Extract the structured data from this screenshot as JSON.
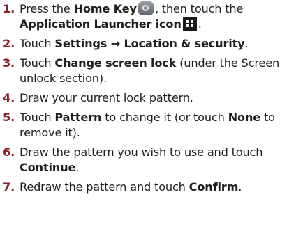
{
  "steps": [
    {
      "num": "1.",
      "parts": [
        {
          "t": "Press the "
        },
        {
          "t": "Home Key",
          "b": true
        },
        {
          "icon": "home-key-icon"
        },
        {
          "t": ", then touch the "
        },
        {
          "t": "Application Launcher icon",
          "b": true
        },
        {
          "icon": "app-launcher-icon"
        },
        {
          "t": "."
        }
      ]
    },
    {
      "num": "2.",
      "parts": [
        {
          "t": "Touch "
        },
        {
          "t": "Settings → Location & security",
          "b": true
        },
        {
          "t": "."
        }
      ]
    },
    {
      "num": "3.",
      "parts": [
        {
          "t": "Touch "
        },
        {
          "t": "Change screen lock",
          "b": true
        },
        {
          "t": " (under the Screen unlock section)."
        }
      ]
    },
    {
      "num": "4.",
      "parts": [
        {
          "t": "Draw your current lock pattern."
        }
      ]
    },
    {
      "num": "5.",
      "parts": [
        {
          "t": "Touch "
        },
        {
          "t": "Pattern",
          "b": true
        },
        {
          "t": " to change it (or touch "
        },
        {
          "t": "None",
          "b": true
        },
        {
          "t": " to remove it)."
        }
      ]
    },
    {
      "num": "6.",
      "parts": [
        {
          "t": "Draw the pattern you wish to use and touch "
        },
        {
          "t": "Continue",
          "b": true
        },
        {
          "t": "."
        }
      ]
    },
    {
      "num": "7.",
      "parts": [
        {
          "t": "Redraw the pattern and touch "
        },
        {
          "t": "Confirm",
          "b": true
        },
        {
          "t": "."
        }
      ]
    }
  ],
  "colors": {
    "number": "#8a1f2a",
    "text": "#1f1f1f"
  }
}
